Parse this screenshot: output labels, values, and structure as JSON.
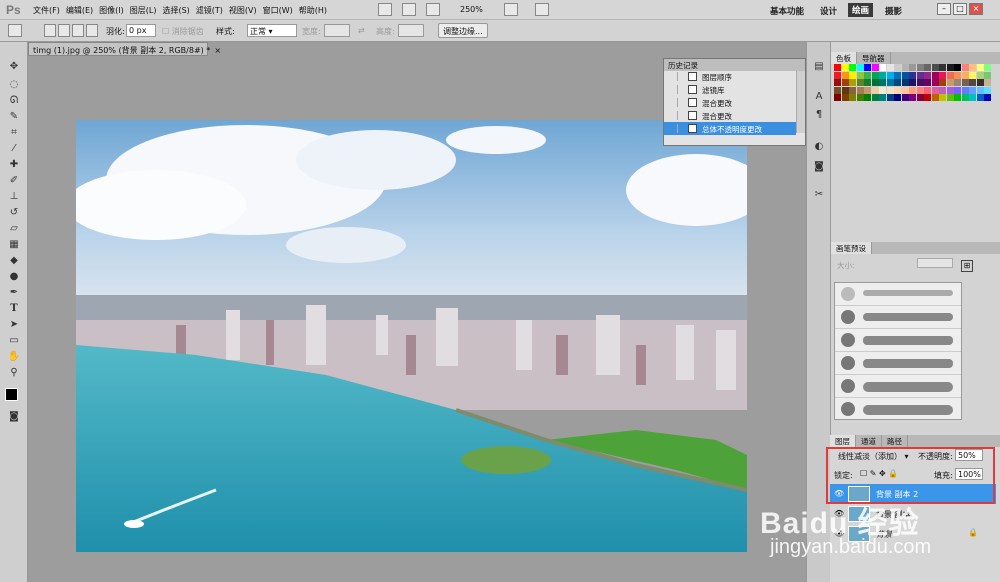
{
  "app": {
    "logo": "Ps"
  },
  "menu": [
    "文件(F)",
    "编辑(E)",
    "图像(I)",
    "图层(L)",
    "选择(S)",
    "滤镜(T)",
    "视图(V)",
    "窗口(W)",
    "帮助(H)"
  ],
  "app_bar": {
    "zoom": "250%"
  },
  "workspaces": {
    "basic": "基本功能",
    "design": "设计",
    "painting": "绘画",
    "photography": "摄影"
  },
  "options": {
    "feather_label": "羽化:",
    "feather_value": "0 px",
    "antialias": "消除锯齿",
    "style_label": "样式:",
    "style_value": "正常",
    "width_label": "宽度:",
    "height_label": "高度:",
    "refine_edge": "调整边缘..."
  },
  "document": {
    "tab_title": "timg (1).jpg @ 250% (背景 副本 2, RGB/8#) *",
    "close": "×"
  },
  "history": {
    "title": "历史记录",
    "items": [
      "图层顺序",
      "滤镜库",
      "混合更改",
      "混合更改",
      "总体不透明度更改"
    ],
    "selected_index": 4
  },
  "swatches": {
    "tabs": [
      "色板",
      "导航器"
    ],
    "colors": [
      "#ff0000",
      "#ffff00",
      "#00ff00",
      "#00ffff",
      "#0000ff",
      "#ff00ff",
      "#ffffff",
      "#e6e6e6",
      "#cccccc",
      "#b3b3b3",
      "#999999",
      "#808080",
      "#666666",
      "#4d4d4d",
      "#333333",
      "#1a1a1a",
      "#000000",
      "#ff7f7f",
      "#ffbf7f",
      "#ffff7f",
      "#7fff7f",
      "#ed1c24",
      "#f7941d",
      "#fff200",
      "#8dc63f",
      "#39b54a",
      "#00a651",
      "#00a99d",
      "#00aeef",
      "#0072bc",
      "#0054a6",
      "#2e3192",
      "#662d91",
      "#92278f",
      "#9e005d",
      "#ed145b",
      "#f26c4f",
      "#f68e56",
      "#fbaf5d",
      "#fff568",
      "#acd373",
      "#7cc576",
      "#9e0b0f",
      "#a0410d",
      "#aba000",
      "#598527",
      "#197b30",
      "#007236",
      "#00746b",
      "#0076a3",
      "#004a80",
      "#003471",
      "#1b1464",
      "#440e62",
      "#630460",
      "#9e005d",
      "#a0410d",
      "#c69c6d",
      "#998675",
      "#736357",
      "#534741",
      "#362f2d",
      "#c7b299",
      "#754c24",
      "#603913",
      "#8c6239",
      "#a67c52",
      "#c49a6c",
      "#e8d0a9",
      "#f5e9d4",
      "#f0e4ca",
      "#ffd5b0",
      "#ffc6a0",
      "#ff9f7f",
      "#ff7f7f",
      "#ff5f7f",
      "#df5fa0",
      "#bf5fbf",
      "#9f5fdf",
      "#7f5fff",
      "#5f7fff",
      "#5f9fff",
      "#5fbfff",
      "#5fdfff",
      "#800000",
      "#804000",
      "#808000",
      "#408000",
      "#008000",
      "#008040",
      "#008080",
      "#004080",
      "#000080",
      "#400080",
      "#800080",
      "#800040",
      "#c00000",
      "#c06000",
      "#c0c000",
      "#60c000",
      "#00c000",
      "#00c060",
      "#00c0c0",
      "#0060c0",
      "#0000c0"
    ]
  },
  "brush_presets": {
    "title": "画笔预设",
    "size_label": "大小:"
  },
  "layers_panel": {
    "tabs": [
      "图层",
      "通道",
      "路径"
    ],
    "blend_mode": "线性减淡（添加）",
    "opacity_label": "不透明度:",
    "opacity_value": "50%",
    "lock_label": "锁定:",
    "fill_label": "填充:",
    "fill_value": "100%",
    "layers": [
      {
        "name": "背景 副本 2",
        "selected": true
      },
      {
        "name": "背景 副本"
      },
      {
        "name": "背景"
      }
    ]
  },
  "watermark": {
    "brand": "Baidu 经验",
    "url": "jingyan.baidu.com"
  }
}
